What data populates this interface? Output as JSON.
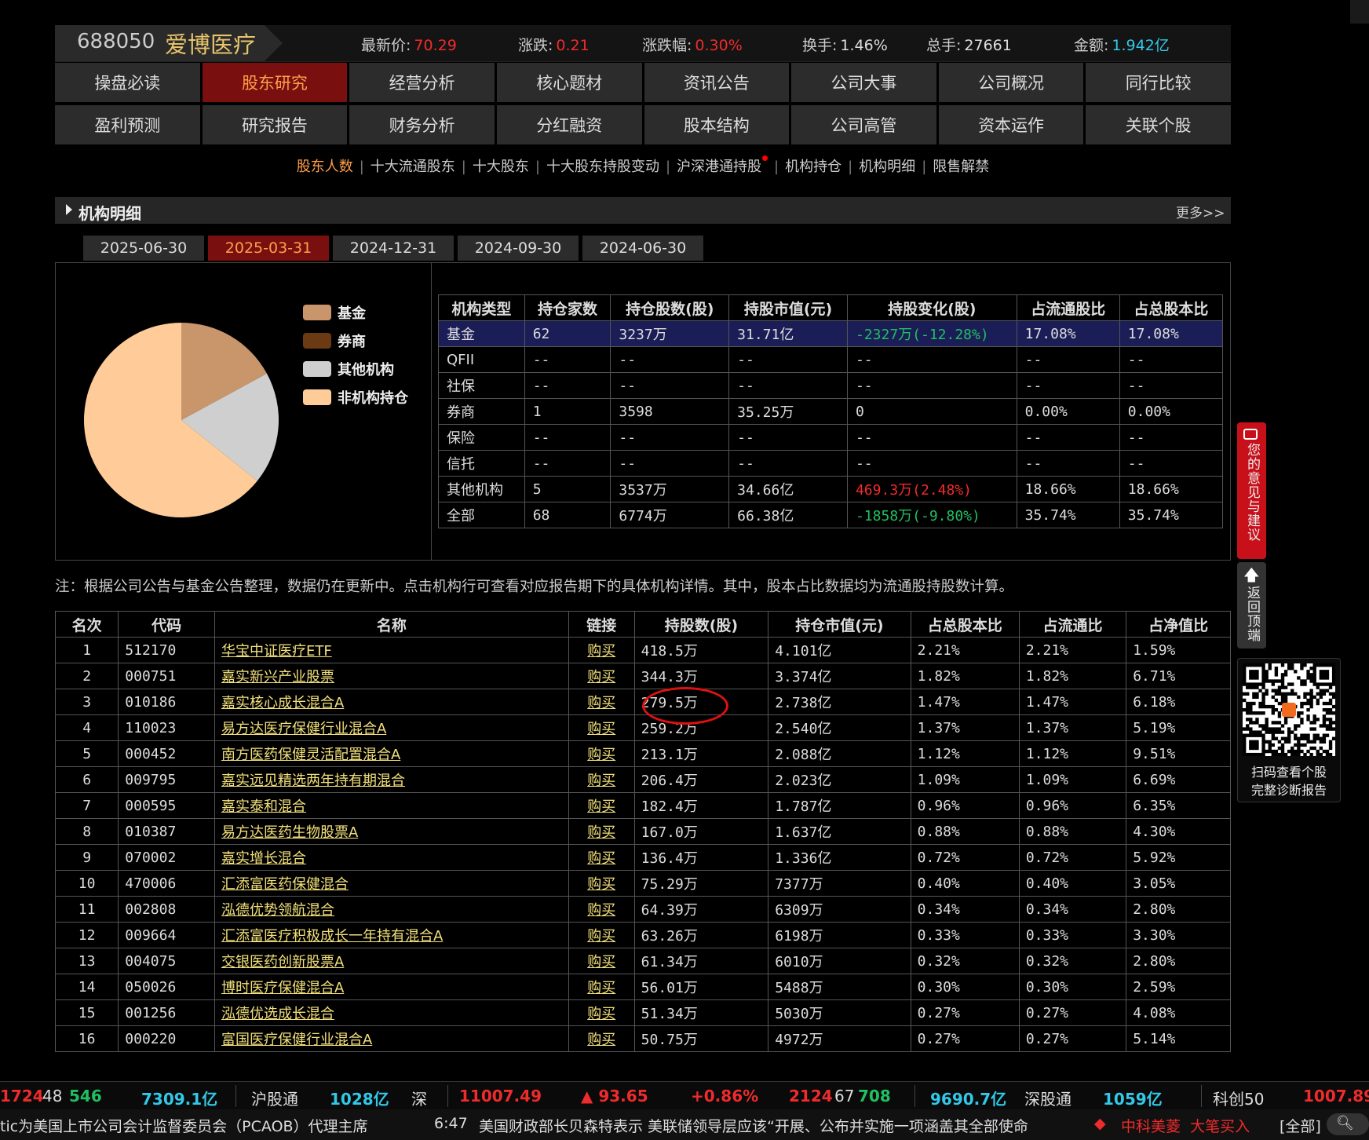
{
  "header": {
    "code": "688050",
    "name": "爱博医疗",
    "items": [
      {
        "label": "最新价:",
        "value": "70.29",
        "color": "red"
      },
      {
        "label": "涨跌:",
        "value": "0.21",
        "color": "red"
      },
      {
        "label": "涨跌幅:",
        "value": "0.30%",
        "color": "red"
      },
      {
        "label": "换手:",
        "value": "1.46%",
        "color": "plain"
      },
      {
        "label": "总手:",
        "value": "27661",
        "color": "plain"
      },
      {
        "label": "金额:",
        "value": "1.942亿",
        "color": "cyan"
      }
    ]
  },
  "nav_row1": [
    "操盘必读",
    "股东研究",
    "经营分析",
    "核心题材",
    "资讯公告",
    "公司大事",
    "公司概况",
    "同行比较"
  ],
  "nav_row2": [
    "盈利预测",
    "研究报告",
    "财务分析",
    "分红融资",
    "股本结构",
    "公司高管",
    "资本运作",
    "关联个股"
  ],
  "subnav": [
    "股东人数",
    "十大流通股东",
    "十大股东",
    "十大股东持股变动",
    "沪深港通持股",
    "机构持仓",
    "机构明细",
    "限售解禁"
  ],
  "section": {
    "title": "机构明细",
    "more": "更多>>"
  },
  "date_tabs": [
    "2025-06-30",
    "2025-03-31",
    "2024-12-31",
    "2024-09-30",
    "2024-06-30"
  ],
  "legend": [
    {
      "label": "基金",
      "color": "#c9956a"
    },
    {
      "label": "券商",
      "color": "#6b3a12"
    },
    {
      "label": "其他机构",
      "color": "#cfcfcf"
    },
    {
      "label": "非机构持仓",
      "color": "#ffcc99"
    }
  ],
  "pie": {
    "slices": [
      {
        "name": "基金",
        "value": 17.08,
        "color": "#c9956a"
      },
      {
        "name": "券商",
        "value": 0.0,
        "color": "#6b3a12"
      },
      {
        "name": "其他机构",
        "value": 18.66,
        "color": "#cfcfcf"
      },
      {
        "name": "非机构持仓",
        "value": 64.26,
        "color": "#ffcc99"
      }
    ]
  },
  "inst_table": {
    "headers": [
      "机构类型",
      "持仓家数",
      "持仓股数(股)",
      "持股市值(元)",
      "持股变化(股)",
      "占流通股比",
      "占总股本比"
    ],
    "rows": [
      {
        "type": "基金",
        "count": "62",
        "shares": "3237万",
        "value": "31.71亿",
        "change": "-2327万(-12.28%)",
        "chg_color": "green",
        "float": "17.08%",
        "total": "17.08%"
      },
      {
        "type": "QFII",
        "count": "--",
        "shares": "--",
        "value": "--",
        "change": "--",
        "chg_color": "plain",
        "float": "--",
        "total": "--"
      },
      {
        "type": "社保",
        "count": "--",
        "shares": "--",
        "value": "--",
        "change": "--",
        "chg_color": "plain",
        "float": "--",
        "total": "--"
      },
      {
        "type": "券商",
        "count": "1",
        "shares": "3598",
        "value": "35.25万",
        "change": "0",
        "chg_color": "plain",
        "float": "0.00%",
        "total": "0.00%"
      },
      {
        "type": "保险",
        "count": "--",
        "shares": "--",
        "value": "--",
        "change": "--",
        "chg_color": "plain",
        "float": "--",
        "total": "--"
      },
      {
        "type": "信托",
        "count": "--",
        "shares": "--",
        "value": "--",
        "change": "--",
        "chg_color": "plain",
        "float": "--",
        "total": "--"
      },
      {
        "type": "其他机构",
        "count": "5",
        "shares": "3537万",
        "value": "34.66亿",
        "change": "469.3万(2.48%)",
        "chg_color": "red",
        "float": "18.66%",
        "total": "18.66%"
      },
      {
        "type": "全部",
        "count": "68",
        "shares": "6774万",
        "value": "66.38亿",
        "change": "-1858万(-9.80%)",
        "chg_color": "green",
        "float": "35.74%",
        "total": "35.74%"
      }
    ]
  },
  "note": "注：根据公司公告与基金公告整理，数据仍在更新中。点击机构行可查看对应报告期下的具体机构详情。其中，股本占比数据均为流通股持股数计算。",
  "fund_table": {
    "headers": [
      "名次",
      "代码",
      "名称",
      "链接",
      "持股数(股)",
      "持仓市值(元)",
      "占总股本比",
      "占流通比",
      "占净值比"
    ],
    "rows": [
      {
        "rank": "1",
        "code": "512170",
        "name": "华宝中证医疗ETF",
        "link": "购买",
        "shares": "418.5万",
        "value": "4.101亿",
        "total": "2.21%",
        "float": "2.21%",
        "nav": "1.59%"
      },
      {
        "rank": "2",
        "code": "000751",
        "name": "嘉实新兴产业股票",
        "link": "购买",
        "shares": "344.3万",
        "value": "3.374亿",
        "total": "1.82%",
        "float": "1.82%",
        "nav": "6.71%"
      },
      {
        "rank": "3",
        "code": "010186",
        "name": "嘉实核心成长混合A",
        "link": "购买",
        "shares": "279.5万",
        "value": "2.738亿",
        "total": "1.47%",
        "float": "1.47%",
        "nav": "6.18%"
      },
      {
        "rank": "4",
        "code": "110023",
        "name": "易方达医疗保健行业混合A",
        "link": "购买",
        "shares": "259.2万",
        "value": "2.540亿",
        "total": "1.37%",
        "float": "1.37%",
        "nav": "5.19%"
      },
      {
        "rank": "5",
        "code": "000452",
        "name": "南方医药保健灵活配置混合A",
        "link": "购买",
        "shares": "213.1万",
        "value": "2.088亿",
        "total": "1.12%",
        "float": "1.12%",
        "nav": "9.51%"
      },
      {
        "rank": "6",
        "code": "009795",
        "name": "嘉实远见精选两年持有期混合",
        "link": "购买",
        "shares": "206.4万",
        "value": "2.023亿",
        "total": "1.09%",
        "float": "1.09%",
        "nav": "6.69%"
      },
      {
        "rank": "7",
        "code": "000595",
        "name": "嘉实泰和混合",
        "link": "购买",
        "shares": "182.4万",
        "value": "1.787亿",
        "total": "0.96%",
        "float": "0.96%",
        "nav": "6.35%"
      },
      {
        "rank": "8",
        "code": "010387",
        "name": "易方达医药生物股票A",
        "link": "购买",
        "shares": "167.0万",
        "value": "1.637亿",
        "total": "0.88%",
        "float": "0.88%",
        "nav": "4.30%"
      },
      {
        "rank": "9",
        "code": "070002",
        "name": "嘉实增长混合",
        "link": "购买",
        "shares": "136.4万",
        "value": "1.336亿",
        "total": "0.72%",
        "float": "0.72%",
        "nav": "5.92%"
      },
      {
        "rank": "10",
        "code": "470006",
        "name": "汇添富医药保健混合",
        "link": "购买",
        "shares": "75.29万",
        "value": "7377万",
        "total": "0.40%",
        "float": "0.40%",
        "nav": "3.05%"
      },
      {
        "rank": "11",
        "code": "002808",
        "name": "泓德优势领航混合",
        "link": "购买",
        "shares": "64.39万",
        "value": "6309万",
        "total": "0.34%",
        "float": "0.34%",
        "nav": "2.80%"
      },
      {
        "rank": "12",
        "code": "009664",
        "name": "汇添富医疗积极成长一年持有混合A",
        "link": "购买",
        "shares": "63.26万",
        "value": "6198万",
        "total": "0.33%",
        "float": "0.33%",
        "nav": "3.30%"
      },
      {
        "rank": "13",
        "code": "004075",
        "name": "交银医药创新股票A",
        "link": "购买",
        "shares": "61.34万",
        "value": "6010万",
        "total": "0.32%",
        "float": "0.32%",
        "nav": "2.80%"
      },
      {
        "rank": "14",
        "code": "050026",
        "name": "博时医疗保健混合A",
        "link": "购买",
        "shares": "56.01万",
        "value": "5488万",
        "total": "0.30%",
        "float": "0.30%",
        "nav": "2.59%"
      },
      {
        "rank": "15",
        "code": "001256",
        "name": "泓德优选成长混合",
        "link": "购买",
        "shares": "51.34万",
        "value": "5030万",
        "total": "0.27%",
        "float": "0.27%",
        "nav": "4.08%"
      },
      {
        "rank": "16",
        "code": "000220",
        "name": "富国医疗保健行业混合A",
        "link": "购买",
        "shares": "50.75万",
        "value": "4972万",
        "total": "0.27%",
        "float": "0.27%",
        "nav": "5.14%"
      }
    ]
  },
  "side": {
    "feedback": "您的意见与建议",
    "back_top": "返回顶端",
    "qr_caption1": "扫码查看个股",
    "qr_caption2": "完整诊断报告"
  },
  "ticker1": [
    {
      "text": "1724",
      "color": "red"
    },
    {
      "text": "48",
      "color": "plain"
    },
    {
      "text": "546",
      "color": "green"
    },
    {
      "text": "7309.1亿",
      "color": "cyan"
    },
    {
      "text": "沪股通",
      "color": "plain"
    },
    {
      "text": "1028亿",
      "color": "cyan"
    },
    {
      "text": "深",
      "color": "plain"
    },
    {
      "text": "11007.49",
      "color": "red"
    },
    {
      "text": "▲ 93.65",
      "color": "red"
    },
    {
      "text": "+0.86%",
      "color": "red"
    },
    {
      "text": "2124",
      "color": "red"
    },
    {
      "text": "67",
      "color": "plain"
    },
    {
      "text": "708",
      "color": "green"
    },
    {
      "text": "9690.7亿",
      "color": "cyan"
    },
    {
      "text": "深股通",
      "color": "plain"
    },
    {
      "text": "1059亿",
      "color": "cyan"
    },
    {
      "text": "科创50",
      "color": "plain"
    },
    {
      "text": "1007.89",
      "color": "red"
    }
  ],
  "ticker2": {
    "news1": "tic为美国上市公司会计监督委员会（PCAOB）代理主席",
    "time": "6:47",
    "news2": "美国财政部长贝森特表示 美联储领导层应该“开展、公布并实施一项涵盖其全部使命",
    "alert": "中科美菱  大笔买入",
    "all": "[全部]"
  }
}
